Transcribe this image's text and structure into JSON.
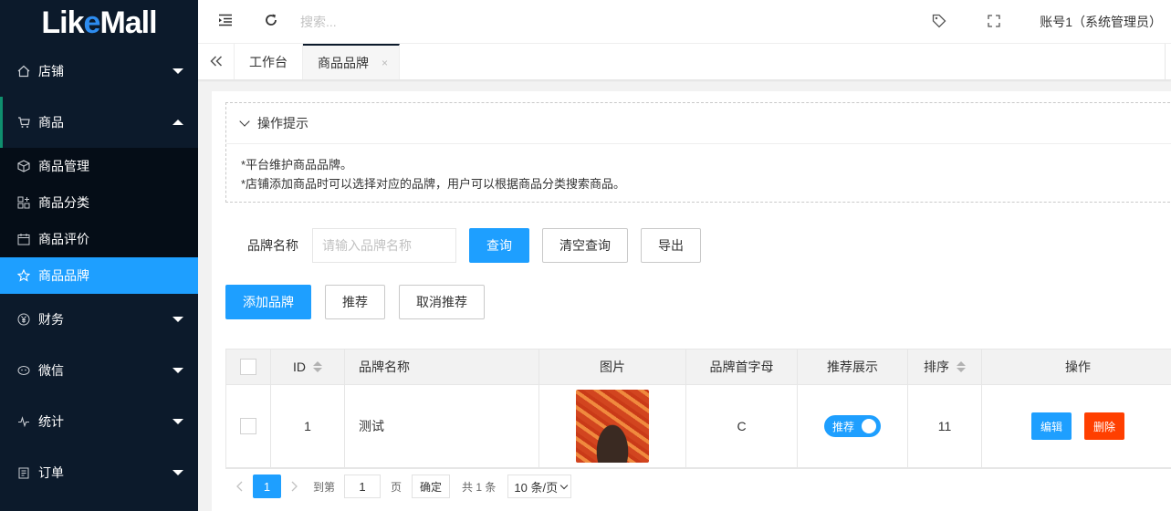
{
  "app": {
    "logo_pre": "Lik",
    "logo_e": "e",
    "logo_post": "Mall"
  },
  "sidebar": {
    "groups": [
      {
        "label": "店铺",
        "icon": "home-icon"
      },
      {
        "label": "商品",
        "icon": "cart-icon"
      },
      {
        "label": "财务",
        "icon": "yen-icon"
      },
      {
        "label": "微信",
        "icon": "wechat-icon"
      },
      {
        "label": "统计",
        "icon": "pulse-icon"
      },
      {
        "label": "订单",
        "icon": "clipboard-icon"
      }
    ],
    "sub_items": [
      {
        "label": "商品管理",
        "icon": "cube-icon"
      },
      {
        "label": "商品分类",
        "icon": "category-icon"
      },
      {
        "label": "商品评价",
        "icon": "calendar-icon"
      },
      {
        "label": "商品品牌",
        "icon": "star-icon",
        "active": true
      }
    ]
  },
  "header": {
    "search_placeholder": "搜索...",
    "account": "账号1（系统管理员）"
  },
  "tabs": [
    {
      "label": "工作台"
    },
    {
      "label": "商品品牌",
      "close": "×",
      "active": true
    }
  ],
  "tips": {
    "title": "操作提示",
    "lines": [
      "*平台维护商品品牌。",
      "*店铺添加商品时可以选择对应的品牌，用户可以根据商品分类搜索商品。"
    ]
  },
  "search_form": {
    "label": "品牌名称",
    "placeholder": "请输入品牌名称",
    "query_btn": "查询",
    "clear_btn": "清空查询",
    "export_btn": "导出"
  },
  "toolbar": {
    "add_btn": "添加品牌",
    "recommend_btn": "推荐",
    "unrecommend_btn": "取消推荐"
  },
  "table": {
    "headers": {
      "id": "ID",
      "name": "品牌名称",
      "image": "图片",
      "letter": "品牌首字母",
      "recommend": "推荐展示",
      "sort": "排序",
      "ops": "操作"
    },
    "rows": [
      {
        "id": "1",
        "name": "测试",
        "letter": "C",
        "recommend": "推荐",
        "recommend_on": true,
        "sort": "11",
        "edit": "编辑",
        "delete": "删除"
      }
    ]
  },
  "pager": {
    "current": "1",
    "goto_label": "到第",
    "goto_value": "1",
    "page_unit": "页",
    "confirm": "确定",
    "total": "共 1 条",
    "page_size": "10 条/页"
  },
  "colors": {
    "sidebar_bg": "#0c1a2b",
    "accent": "#1e9fff",
    "danger": "#ff3f00"
  }
}
